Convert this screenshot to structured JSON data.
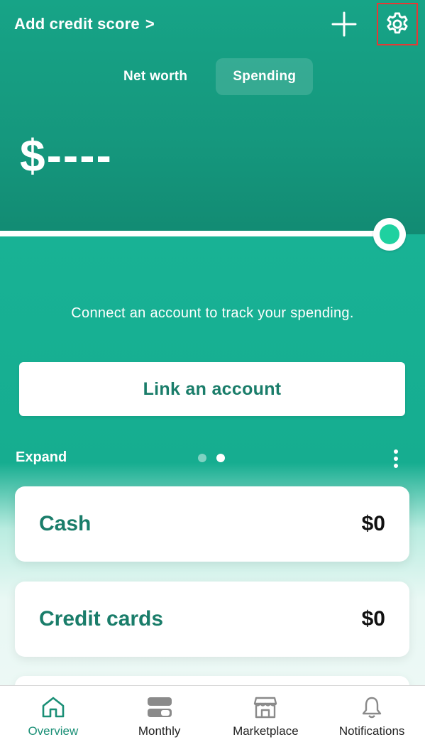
{
  "header": {
    "credit_link_label": "Add credit score",
    "chevron": ">"
  },
  "tabs": [
    {
      "label": "Net worth",
      "active": false
    },
    {
      "label": "Spending",
      "active": true
    }
  ],
  "amount": "$----",
  "connect_message": "Connect an account to track your spending.",
  "link_button_label": "Link an account",
  "expand_label": "Expand",
  "pager": {
    "count": 2,
    "active_index": 1
  },
  "cards": [
    {
      "label": "Cash",
      "value": "$0"
    },
    {
      "label": "Credit cards",
      "value": "$0"
    }
  ],
  "bottom_nav": [
    {
      "label": "Overview",
      "icon": "home-icon",
      "active": true
    },
    {
      "label": "Monthly",
      "icon": "monthly-icon",
      "active": false
    },
    {
      "label": "Marketplace",
      "icon": "store-icon",
      "active": false
    },
    {
      "label": "Notifications",
      "icon": "bell-icon",
      "active": false
    }
  ],
  "colors": {
    "brand_green": "#17a487",
    "accent_text": "#1a7d6a",
    "knob_green": "#1fd1a0",
    "highlight_red": "#e53935"
  }
}
